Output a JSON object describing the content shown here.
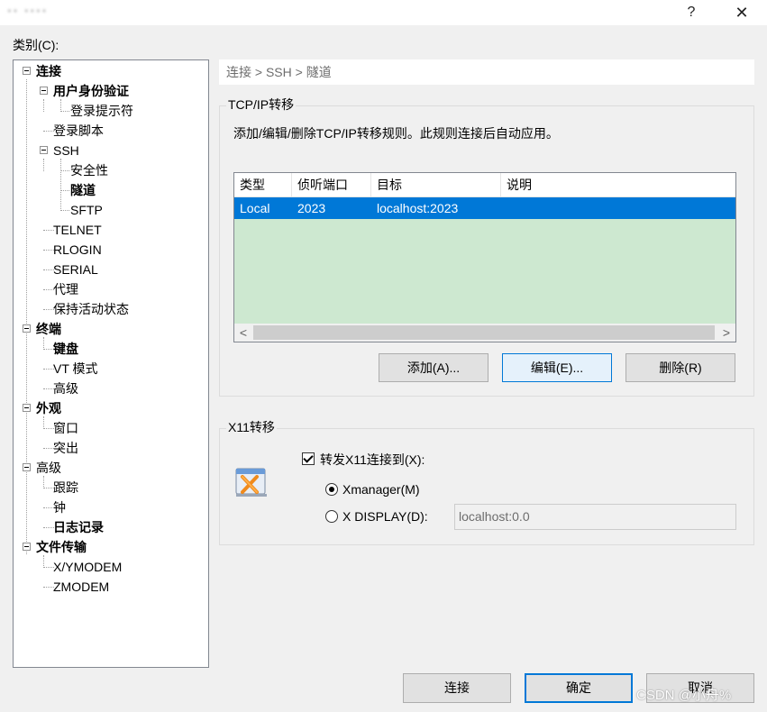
{
  "titlebar": {
    "title": "▪▪ ▪▪▪▪",
    "help": "?",
    "close": "✕"
  },
  "category_label": "类别(C):",
  "tree": {
    "items": [
      {
        "label": "连接",
        "bold": true
      },
      {
        "label": "用户身份验证",
        "bold": true
      },
      {
        "label": "登录提示符",
        "bold": false
      },
      {
        "label": "登录脚本",
        "bold": false
      },
      {
        "label": "SSH",
        "bold": false
      },
      {
        "label": "安全性",
        "bold": false
      },
      {
        "label": "隧道",
        "bold": true
      },
      {
        "label": "SFTP",
        "bold": false
      },
      {
        "label": "TELNET",
        "bold": false
      },
      {
        "label": "RLOGIN",
        "bold": false
      },
      {
        "label": "SERIAL",
        "bold": false
      },
      {
        "label": "代理",
        "bold": false
      },
      {
        "label": "保持活动状态",
        "bold": false
      },
      {
        "label": "终端",
        "bold": true
      },
      {
        "label": "键盘",
        "bold": true
      },
      {
        "label": "VT 模式",
        "bold": false
      },
      {
        "label": "高级",
        "bold": false
      },
      {
        "label": "外观",
        "bold": true
      },
      {
        "label": "窗口",
        "bold": false
      },
      {
        "label": "突出",
        "bold": false
      },
      {
        "label": "高级",
        "bold": false
      },
      {
        "label": "跟踪",
        "bold": false
      },
      {
        "label": "钟",
        "bold": false
      },
      {
        "label": "日志记录",
        "bold": true
      },
      {
        "label": "文件传输",
        "bold": true
      },
      {
        "label": "X/YMODEM",
        "bold": false
      },
      {
        "label": "ZMODEM",
        "bold": false
      }
    ]
  },
  "breadcrumb": "连接 > SSH > 隧道",
  "tcpip": {
    "group_title": "TCP/IP转移",
    "description": "添加/编辑/删除TCP/IP转移规则。此规则连接后自动应用。",
    "columns": [
      "类型",
      "侦听端口",
      "目标",
      "说明"
    ],
    "rows": [
      {
        "type": "Local",
        "port": "2023",
        "target": "localhost:2023",
        "desc": ""
      }
    ],
    "scroll_left": "<",
    "scroll_right": ">",
    "add_button": "添加(A)...",
    "edit_button": "编辑(E)...",
    "delete_button": "删除(R)"
  },
  "x11": {
    "group_title": "X11转移",
    "forward_label": "转发X11连接到(X):",
    "forward_checked": true,
    "xmanager_label": "Xmanager(M)",
    "xdisplay_label": "X DISPLAY(D):",
    "xdisplay_value": "localhost:0.0",
    "selected": "xmanager",
    "icon": "xmanager-icon"
  },
  "footer": {
    "connect_button": "连接",
    "ok_button": "确定",
    "cancel_button": "取消"
  },
  "watermark": "CSDN @小舟%",
  "colors": {
    "selection": "#0078d7",
    "list_background": "#cde8d0",
    "dialog_background": "#f0f0f0"
  }
}
